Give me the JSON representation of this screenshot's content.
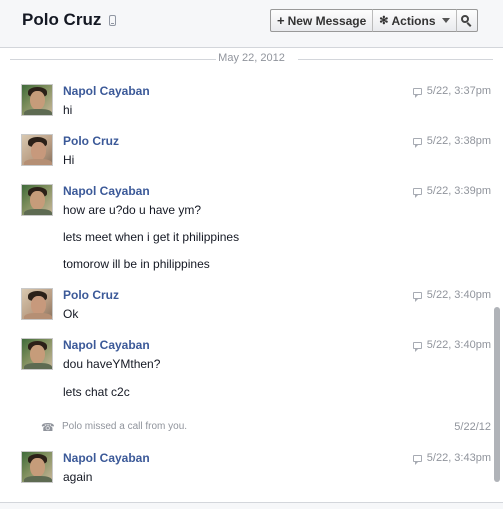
{
  "header": {
    "title": "Polo Cruz",
    "new_message_label": "New Message",
    "actions_label": "Actions"
  },
  "date_separator": "May 22, 2012",
  "messages": [
    {
      "sender": "Napol Cayaban",
      "time": "5/22, 3:37pm",
      "lines": [
        "hi"
      ]
    },
    {
      "sender": "Polo Cruz",
      "time": "5/22, 3:38pm",
      "lines": [
        "Hi"
      ]
    },
    {
      "sender": "Napol Cayaban",
      "time": "5/22, 3:39pm",
      "lines": [
        "how are u?do u have ym?",
        "lets meet when i get it philippines",
        "tomorow ill be in philippines"
      ]
    },
    {
      "sender": "Polo Cruz",
      "time": "5/22, 3:40pm",
      "lines": [
        "Ok"
      ]
    },
    {
      "sender": "Napol Cayaban",
      "time": "5/22, 3:40pm",
      "lines": [
        "dou haveYMthen?",
        "lets chat c2c"
      ]
    },
    {
      "sender": "Napol Cayaban",
      "time": "5/22, 3:43pm",
      "lines": [
        "again"
      ]
    }
  ],
  "missed_call": {
    "text": "Polo missed a call from you.",
    "date": "5/22/12"
  },
  "icons": {
    "new_message": "plus-icon",
    "actions": "gear-icon",
    "search": "search-icon",
    "timestamp": "chat-bubble-icon",
    "missed_call": "phone-icon"
  },
  "colors": {
    "sender_link": "#3b5998",
    "timestamp": "#90949c",
    "header_bg": "#f6f7f9"
  }
}
